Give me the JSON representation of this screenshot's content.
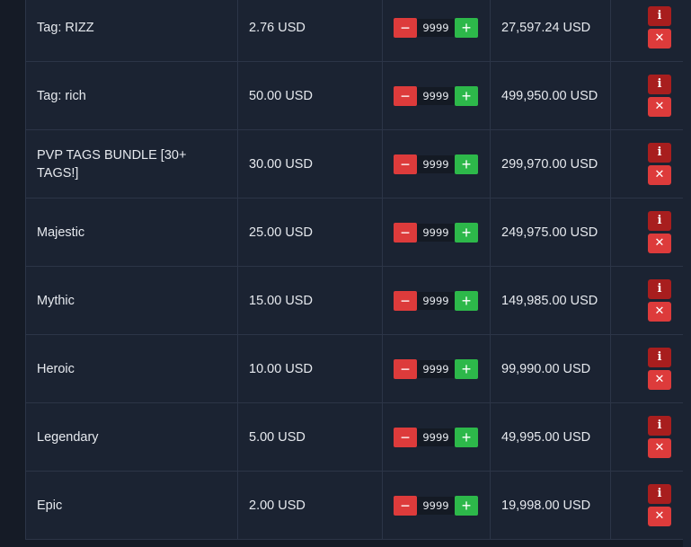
{
  "cart": {
    "currency_symbol_icon": "i-icon",
    "delete_icon": "x-icon",
    "rows": [
      {
        "name": "Tag: RIZZ",
        "price": "2.76 USD",
        "quantity": "9999",
        "total": "27,597.24 USD"
      },
      {
        "name": "Tag: rich",
        "price": "50.00 USD",
        "quantity": "9999",
        "total": "499,950.00 USD"
      },
      {
        "name": "PVP TAGS BUNDLE [30+ TAGS!]",
        "price": "30.00 USD",
        "quantity": "9999",
        "total": "299,970.00 USD"
      },
      {
        "name": "Majestic",
        "price": "25.00 USD",
        "quantity": "9999",
        "total": "249,975.00 USD"
      },
      {
        "name": "Mythic",
        "price": "15.00 USD",
        "quantity": "9999",
        "total": "149,985.00 USD"
      },
      {
        "name": "Heroic",
        "price": "10.00 USD",
        "quantity": "9999",
        "total": "99,990.00 USD"
      },
      {
        "name": "Legendary",
        "price": "5.00 USD",
        "quantity": "9999",
        "total": "49,995.00 USD"
      },
      {
        "name": "Epic",
        "price": "2.00 USD",
        "quantity": "9999",
        "total": "19,998.00 USD"
      }
    ],
    "buttons": {
      "minus": "−",
      "plus": "+",
      "info": "i",
      "delete": "✕"
    },
    "colors": {
      "minus": "#dd3b3b",
      "plus": "#2db84a",
      "info": "#a81e1e",
      "delete": "#dd3b3b",
      "background": "#1b2332"
    }
  }
}
